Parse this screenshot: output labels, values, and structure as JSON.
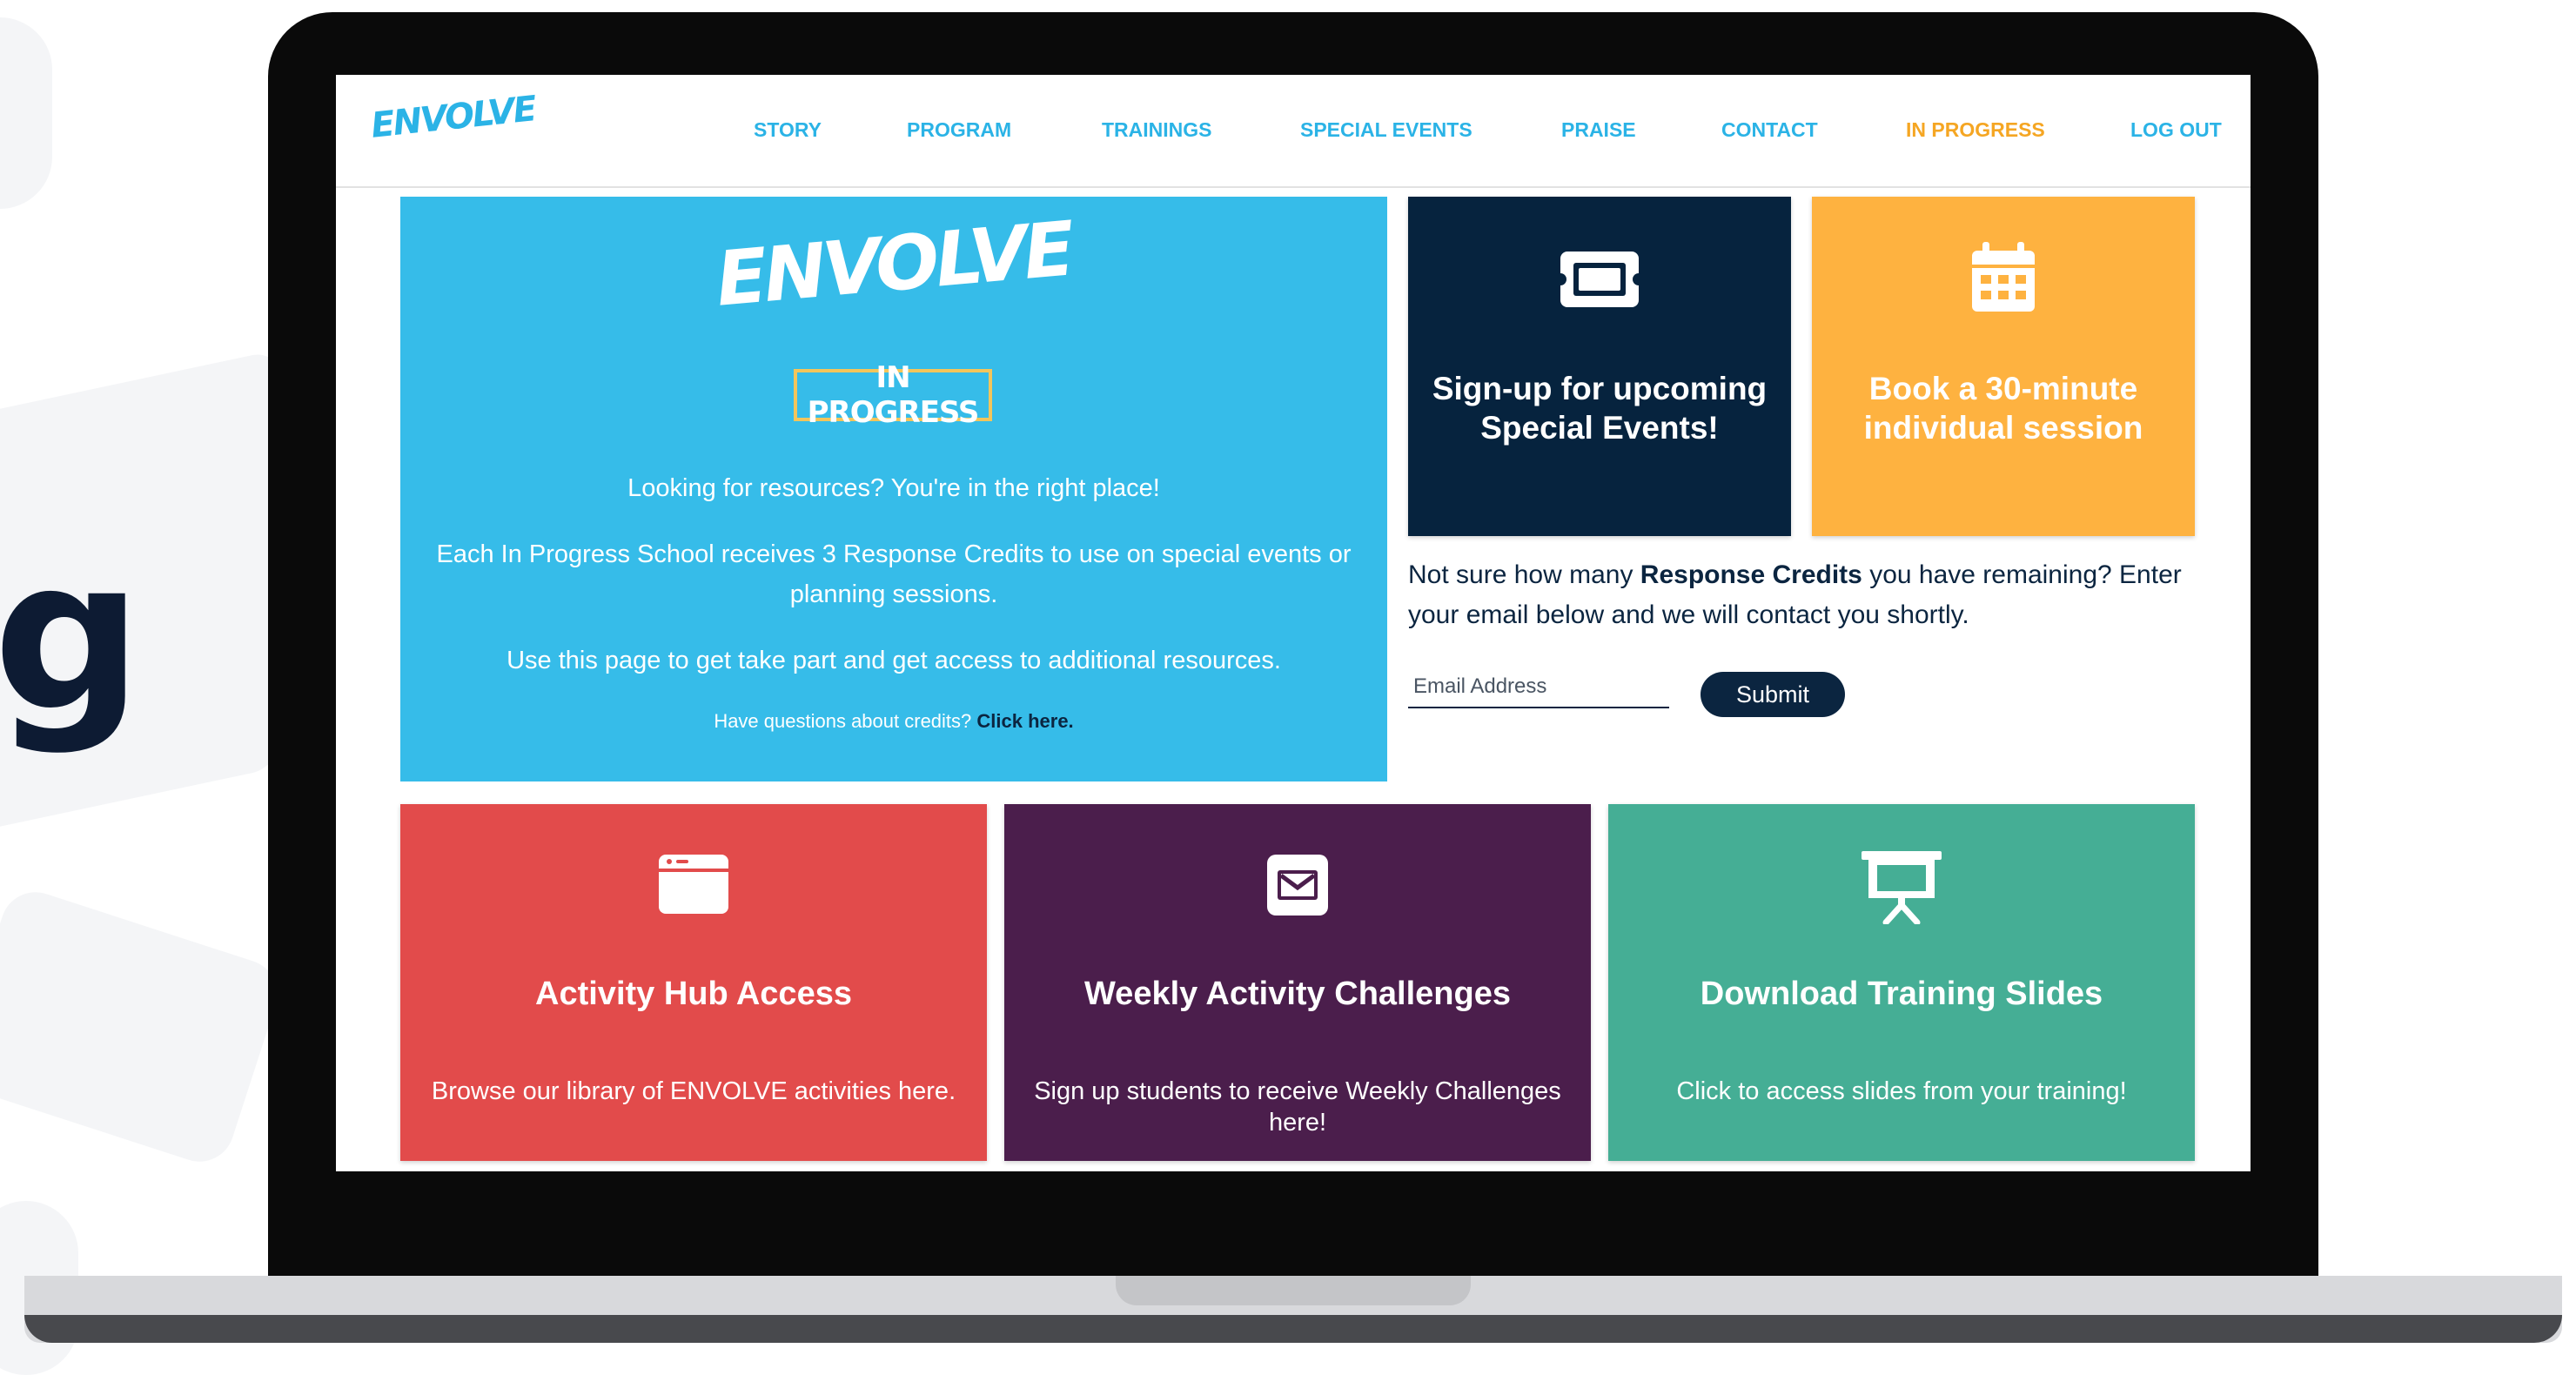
{
  "side_glyph": "g",
  "nav": {
    "logo": "ENVOLVE",
    "links": [
      "STORY",
      "PROGRAM",
      "TRAININGS",
      "SPECIAL EVENTS",
      "PRAISE",
      "CONTACT",
      "IN PROGRESS",
      "LOG OUT"
    ],
    "active_link": "IN PROGRESS"
  },
  "hero": {
    "logo": "ENVOLVE",
    "badge": "IN PROGRESS",
    "line1": "Looking for resources? You're in the right place!",
    "line2": "Each In Progress School receives 3 Response Credits to use on special events or planning sessions.",
    "line3": "Use this page to get take part and get access to additional resources.",
    "question": "Have questions about credits? ",
    "link": "Click here."
  },
  "cards": {
    "events_title": "Sign-up for upcoming Special Events!",
    "book_title": "Book a 30-minute individual session"
  },
  "credits": {
    "pre": "Not sure how many ",
    "bold": "Response Credits",
    "post": " you have remaining? Enter your email below and we will contact you shortly.",
    "email_placeholder": "Email Address",
    "submit": "Submit"
  },
  "bottom": {
    "hub_title": "Activity Hub Access",
    "hub_desc": "Browse our library of ENVOLVE activities here.",
    "weekly_title": "Weekly Activity Challenges",
    "weekly_desc": "Sign up students to receive Weekly Challenges here!",
    "slides_title": "Download Training Slides",
    "slides_desc": "Click to access slides from your training!"
  },
  "colors": {
    "accent_blue": "#36bce9",
    "navy": "#06233e",
    "orange": "#feb240",
    "red": "#e24b4b",
    "purple": "#4b1e4c",
    "green": "#45ae95"
  },
  "icons": {
    "events": "ticket-icon",
    "book": "calendar-icon",
    "hub": "browser-window-icon",
    "weekly": "envelope-icon",
    "slides": "presentation-board-icon"
  }
}
